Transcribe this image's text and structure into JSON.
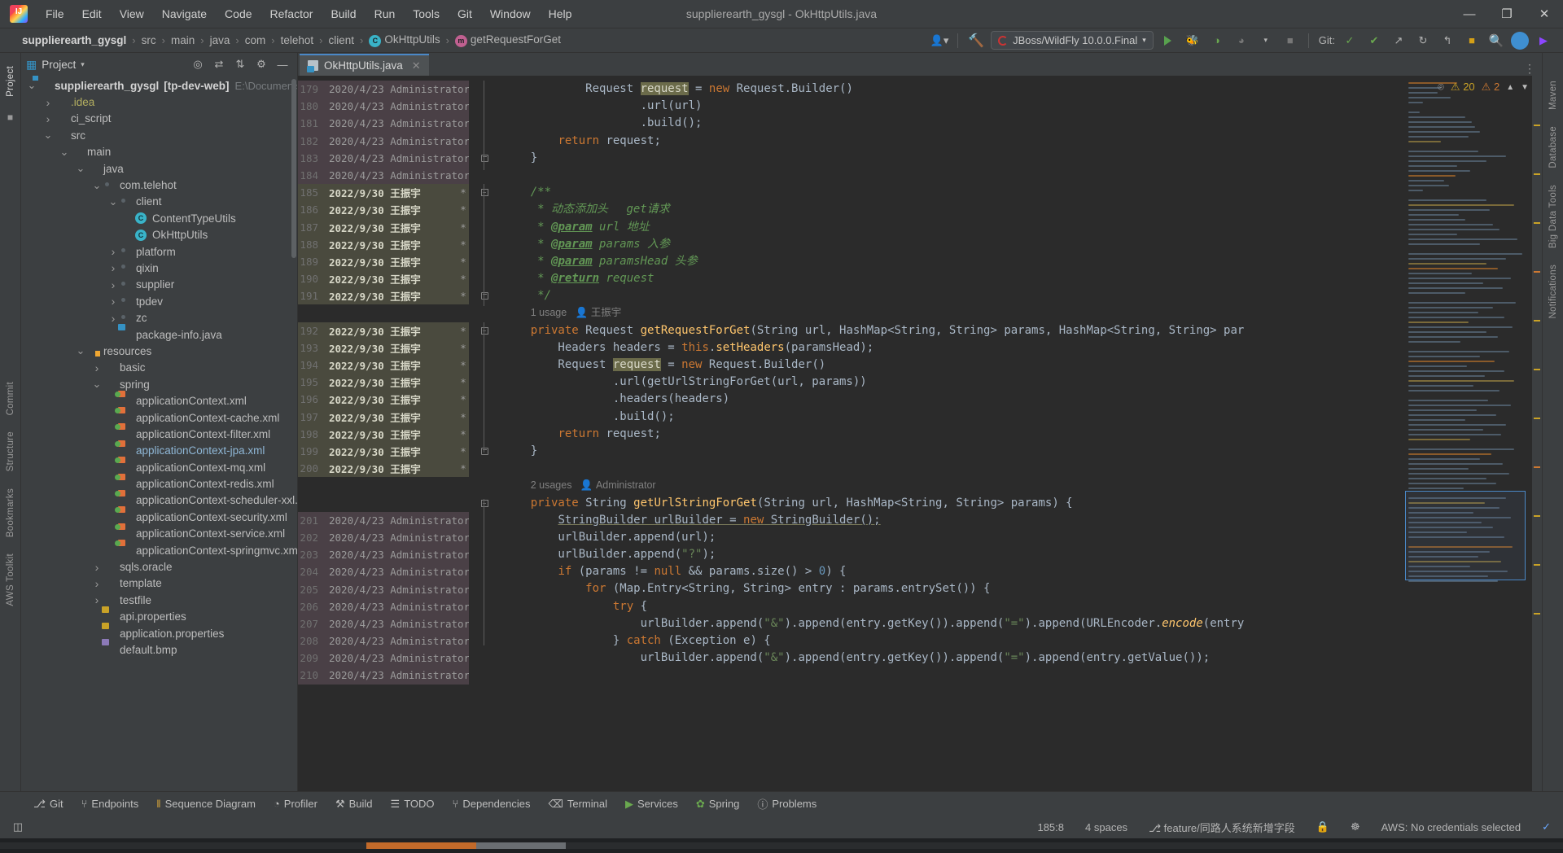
{
  "window": {
    "title": "supplierearth_gysgl - OkHttpUtils.java"
  },
  "menu": [
    "File",
    "Edit",
    "View",
    "Navigate",
    "Code",
    "Refactor",
    "Build",
    "Run",
    "Tools",
    "Git",
    "Window",
    "Help"
  ],
  "window_controls": {
    "minimize": "—",
    "maximize": "❐",
    "close": "✕"
  },
  "breadcrumb": [
    {
      "label": "supplierearth_gysgl",
      "badge": ""
    },
    {
      "label": "src",
      "badge": ""
    },
    {
      "label": "main",
      "badge": ""
    },
    {
      "label": "java",
      "badge": ""
    },
    {
      "label": "com",
      "badge": ""
    },
    {
      "label": "telehot",
      "badge": ""
    },
    {
      "label": "client",
      "badge": ""
    },
    {
      "label": "OkHttpUtils",
      "badge": "C"
    },
    {
      "label": "getRequestForGet",
      "badge": "m"
    }
  ],
  "toolbar": {
    "run_config": "JBoss/WildFly 10.0.0.Final",
    "git_label": "Git:",
    "avatar_initial": " "
  },
  "project_panel": {
    "title": "Project",
    "tree": [
      {
        "depth": 0,
        "arrow": "v",
        "icon": "proj",
        "label": "supplierearth_gysgl",
        "bold": true,
        "suffix": "[tp-dev-web]",
        "path": "E:\\Documents\\Git\\gy"
      },
      {
        "depth": 1,
        "arrow": ">",
        "icon": "folder",
        "label": ".idea",
        "color": "yellow"
      },
      {
        "depth": 1,
        "arrow": ">",
        "icon": "folder",
        "label": "ci_script"
      },
      {
        "depth": 1,
        "arrow": "v",
        "icon": "folder",
        "label": "src"
      },
      {
        "depth": 2,
        "arrow": "v",
        "icon": "folder",
        "label": "main"
      },
      {
        "depth": 3,
        "arrow": "v",
        "icon": "folderblue",
        "label": "java"
      },
      {
        "depth": 4,
        "arrow": "v",
        "icon": "mod",
        "label": "com.telehot"
      },
      {
        "depth": 5,
        "arrow": "v",
        "icon": "mod",
        "label": "client"
      },
      {
        "depth": 6,
        "arrow": "",
        "icon": "class",
        "label": "ContentTypeUtils"
      },
      {
        "depth": 6,
        "arrow": "",
        "icon": "class",
        "label": "OkHttpUtils"
      },
      {
        "depth": 5,
        "arrow": ">",
        "icon": "mod",
        "label": "platform"
      },
      {
        "depth": 5,
        "arrow": ">",
        "icon": "mod",
        "label": "qixin"
      },
      {
        "depth": 5,
        "arrow": ">",
        "icon": "mod",
        "label": "supplier"
      },
      {
        "depth": 5,
        "arrow": ">",
        "icon": "mod",
        "label": "tpdev"
      },
      {
        "depth": 5,
        "arrow": ">",
        "icon": "mod",
        "label": "zc"
      },
      {
        "depth": 5,
        "arrow": "",
        "icon": "java",
        "label": "package-info.java"
      },
      {
        "depth": 3,
        "arrow": "v",
        "icon": "res",
        "label": "resources"
      },
      {
        "depth": 4,
        "arrow": ">",
        "icon": "folder",
        "label": "basic"
      },
      {
        "depth": 4,
        "arrow": "v",
        "icon": "folder",
        "label": "spring"
      },
      {
        "depth": 5,
        "arrow": "",
        "icon": "xml",
        "label": "applicationContext.xml"
      },
      {
        "depth": 5,
        "arrow": "",
        "icon": "xml",
        "label": "applicationContext-cache.xml"
      },
      {
        "depth": 5,
        "arrow": "",
        "icon": "xml",
        "label": "applicationContext-filter.xml"
      },
      {
        "depth": 5,
        "arrow": "",
        "icon": "xml",
        "label": "applicationContext-jpa.xml",
        "color": "sel"
      },
      {
        "depth": 5,
        "arrow": "",
        "icon": "xml",
        "label": "applicationContext-mq.xml"
      },
      {
        "depth": 5,
        "arrow": "",
        "icon": "xml",
        "label": "applicationContext-redis.xml"
      },
      {
        "depth": 5,
        "arrow": "",
        "icon": "xml",
        "label": "applicationContext-scheduler-xxl.xml"
      },
      {
        "depth": 5,
        "arrow": "",
        "icon": "xml",
        "label": "applicationContext-security.xml"
      },
      {
        "depth": 5,
        "arrow": "",
        "icon": "xml",
        "label": "applicationContext-service.xml"
      },
      {
        "depth": 5,
        "arrow": "",
        "icon": "xml",
        "label": "applicationContext-springmvc.xml"
      },
      {
        "depth": 4,
        "arrow": ">",
        "icon": "folder",
        "label": "sqls.oracle"
      },
      {
        "depth": 4,
        "arrow": ">",
        "icon": "folder",
        "label": "template"
      },
      {
        "depth": 4,
        "arrow": ">",
        "icon": "folder",
        "label": "testfile"
      },
      {
        "depth": 4,
        "arrow": "",
        "icon": "prop",
        "label": "api.properties"
      },
      {
        "depth": 4,
        "arrow": "",
        "icon": "prop",
        "label": "application.properties"
      },
      {
        "depth": 4,
        "arrow": "",
        "icon": "bmp",
        "label": "default.bmp"
      }
    ]
  },
  "left_strip": [
    "Project",
    "Commit",
    "Structure",
    "Bookmarks",
    "AWS Toolkit"
  ],
  "right_strip": [
    "Maven",
    "Database",
    "Big Data Tools",
    "Notifications"
  ],
  "editor": {
    "tab": {
      "label": "OkHttpUtils.java",
      "close": "✕"
    },
    "inspection": {
      "warnings": "20",
      "weak": "2",
      "eye": "⌾"
    },
    "annotations": [
      {
        "line": "179",
        "text": "2020/4/23 Administrator",
        "star": "",
        "group": "g1"
      },
      {
        "line": "180",
        "text": "2020/4/23 Administrator",
        "star": "",
        "group": "g1"
      },
      {
        "line": "181",
        "text": "2020/4/23 Administrator",
        "star": "",
        "group": "g1"
      },
      {
        "line": "182",
        "text": "2020/4/23 Administrator",
        "star": "",
        "group": "g1"
      },
      {
        "line": "183",
        "text": "2020/4/23 Administrator",
        "star": "",
        "group": "g1"
      },
      {
        "line": "184",
        "text": "2020/4/23 Administrator",
        "star": "",
        "group": "g1"
      },
      {
        "line": "185",
        "text": "2022/9/30 王振宇",
        "star": "*",
        "group": "g2"
      },
      {
        "line": "186",
        "text": "2022/9/30 王振宇",
        "star": "*",
        "group": "g2"
      },
      {
        "line": "187",
        "text": "2022/9/30 王振宇",
        "star": "*",
        "group": "g2"
      },
      {
        "line": "188",
        "text": "2022/9/30 王振宇",
        "star": "*",
        "group": "g2"
      },
      {
        "line": "189",
        "text": "2022/9/30 王振宇",
        "star": "*",
        "group": "g2"
      },
      {
        "line": "190",
        "text": "2022/9/30 王振宇",
        "star": "*",
        "group": "g2"
      },
      {
        "line": "191",
        "text": "2022/9/30 王振宇",
        "star": "*",
        "group": "g2"
      },
      {
        "line": "",
        "text": "",
        "star": "",
        "group": "g3"
      },
      {
        "line": "192",
        "text": "2022/9/30 王振宇",
        "star": "*",
        "group": "g2"
      },
      {
        "line": "193",
        "text": "2022/9/30 王振宇",
        "star": "*",
        "group": "g2"
      },
      {
        "line": "194",
        "text": "2022/9/30 王振宇",
        "star": "*",
        "group": "g2"
      },
      {
        "line": "195",
        "text": "2022/9/30 王振宇",
        "star": "*",
        "group": "g2"
      },
      {
        "line": "196",
        "text": "2022/9/30 王振宇",
        "star": "*",
        "group": "g2"
      },
      {
        "line": "197",
        "text": "2022/9/30 王振宇",
        "star": "*",
        "group": "g2"
      },
      {
        "line": "198",
        "text": "2022/9/30 王振宇",
        "star": "*",
        "group": "g2"
      },
      {
        "line": "199",
        "text": "2022/9/30 王振宇",
        "star": "*",
        "group": "g2"
      },
      {
        "line": "200",
        "text": "2022/9/30 王振宇",
        "star": "*",
        "group": "g2"
      },
      {
        "line": "",
        "text": "",
        "star": "",
        "group": "g3"
      },
      {
        "line": "",
        "text": "",
        "star": "",
        "group": "g3"
      },
      {
        "line": "201",
        "text": "2020/4/23 Administrator",
        "star": "@",
        "group": "g1"
      },
      {
        "line": "202",
        "text": "2020/4/23 Administrator",
        "star": "",
        "group": "g1"
      },
      {
        "line": "203",
        "text": "2020/4/23 Administrator",
        "star": "",
        "group": "g1"
      },
      {
        "line": "204",
        "text": "2020/4/23 Administrator",
        "star": "",
        "group": "g1"
      },
      {
        "line": "205",
        "text": "2020/4/23 Administrator",
        "star": "",
        "group": "g1"
      },
      {
        "line": "206",
        "text": "2020/4/23 Administrator",
        "star": "",
        "group": "g1"
      },
      {
        "line": "207",
        "text": "2020/4/23 Administrator",
        "star": "",
        "group": "g1"
      },
      {
        "line": "208",
        "text": "2020/4/23 Administrator",
        "star": "",
        "group": "g1"
      },
      {
        "line": "209",
        "text": "2020/4/23 Administrator",
        "star": "",
        "group": "g1"
      },
      {
        "line": "210",
        "text": "2020/4/23 Administrator",
        "star": "",
        "group": "g1"
      }
    ],
    "code_lines": [
      "            Request <hl>request</hl> = <k>new</k> Request.Builder()",
      "                    .url(url)",
      "                    .build();",
      "        <k>return</k> request;",
      "    }",
      "",
      "    <c>/**</c>",
      "     <c>* 动态添加头　 get请求</c>",
      "     <c>* <u>@param</u> url 地址</c>",
      "     <c>* <u>@param</u> params 入参</c>",
      "     <c>* <u>@param</u> paramsHead 头参</c>",
      "     <c>* <u>@return</u> request</c>",
      "     <c>*/</c>",
      "USAGE:1 usage|王振宇",
      "    <k>private</k> Request <m>getRequestForGet</m>(String url, HashMap&lt;String, String&gt; params, HashMap&lt;String, String&gt; par",
      "        Headers headers = <k>this</k>.<m>setHeaders</m>(paramsHead);",
      "        Request <hl>request</hl> = <k>new</k> Request.Builder()",
      "                .url(getUrlStringForGet(url, params))",
      "                .headers(headers)",
      "                .build();",
      "        <k>return</k> request;",
      "    }",
      "",
      "USAGE:2 usages|Administrator",
      "    <k>private</k> String <m>getUrlStringForGet</m>(String url, HashMap&lt;String, String&gt; params) {",
      "        <u2>StringBuilder urlBuilder</u> = <k>new</k> <u2>StringBuilder();</u2>",
      "        urlBuilder.append(url);",
      "        urlBuilder.append(<s>\"?\"</s>);",
      "        <k>if</k> (params != <k>null</k> &amp;&amp; params.size() &gt; <n>0</n>) {",
      "            <k>for</k> (Map.Entry&lt;String, String&gt; entry : params.entrySet()) {",
      "                <k>try</k> {",
      "                    urlBuilder.append(<s>\"&amp;\"</s>).append(entry.getKey()).append(<s>\"=\"</s>).append(URLEncoder.<i>encode</i>(entry",
      "                } <k>catch</k> (Exception e) {",
      "                    urlBuilder.append(<s>\"&amp;\"</s>).append(entry.getKey()).append(<s>\"=\"</s>).append(entry.getValue());"
    ]
  },
  "bottom_tabs": [
    {
      "label": "Git",
      "icon": "git-icon"
    },
    {
      "label": "Endpoints",
      "icon": "endpoints-icon"
    },
    {
      "label": "Sequence Diagram",
      "icon": "sequence-icon"
    },
    {
      "label": "Profiler",
      "icon": "profiler-icon"
    },
    {
      "label": "Build",
      "icon": "build-icon"
    },
    {
      "label": "TODO",
      "icon": "todo-icon"
    },
    {
      "label": "Dependencies",
      "icon": "dependencies-icon"
    },
    {
      "label": "Terminal",
      "icon": "terminal-icon"
    },
    {
      "label": "Services",
      "icon": "services-icon"
    },
    {
      "label": "Spring",
      "icon": "spring-icon"
    },
    {
      "label": "Problems",
      "icon": "problems-icon"
    }
  ],
  "status_bar": {
    "caret": "185:8",
    "indent": "4 spaces",
    "branch": "feature/同路人系统新增字段",
    "aws": "AWS: No credentials selected"
  }
}
